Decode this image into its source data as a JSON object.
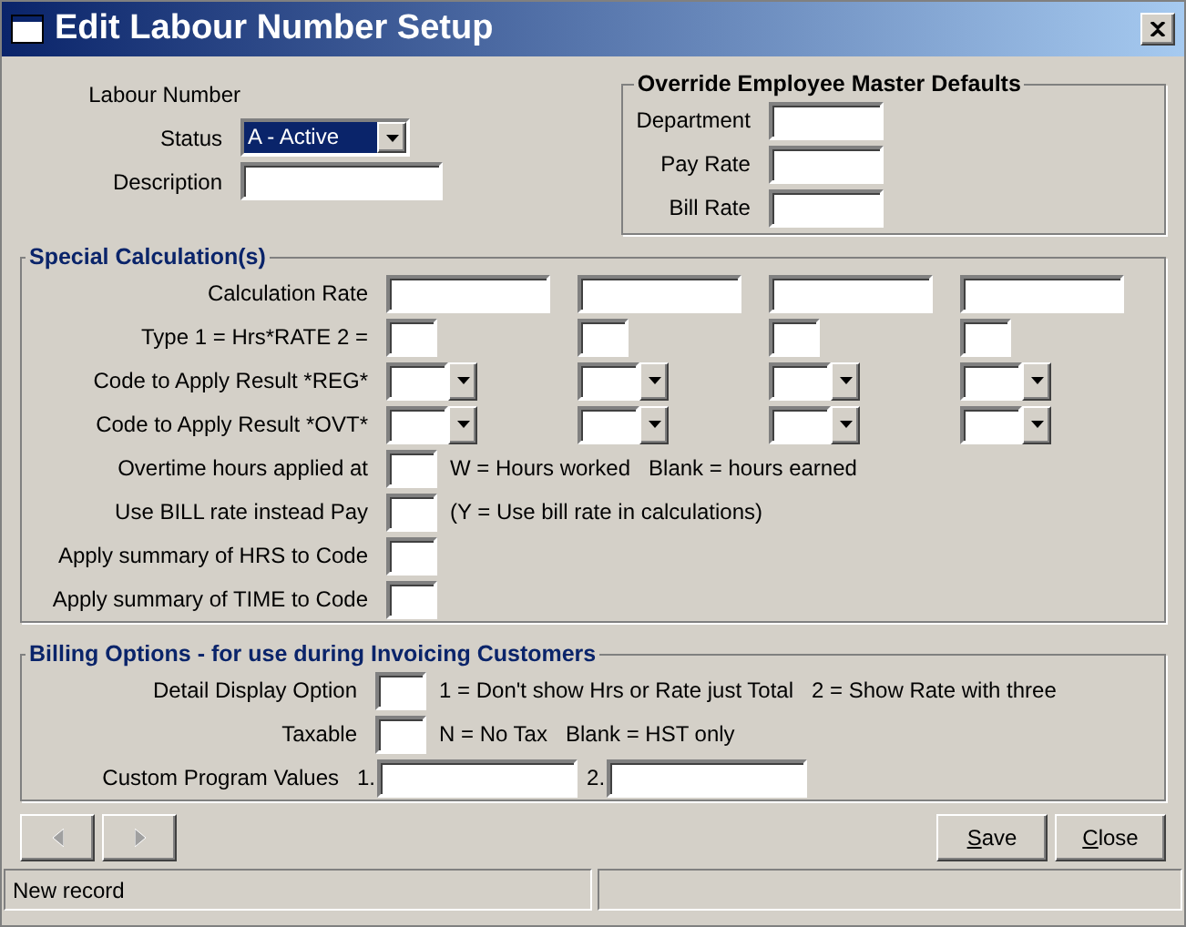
{
  "window": {
    "title": "Edit Labour Number Setup"
  },
  "header": {
    "labour_number_label": "Labour Number",
    "status": {
      "label": "Status",
      "value": "A - Active"
    },
    "description": {
      "label": "Description"
    }
  },
  "override": {
    "title": "Override Employee Master Defaults",
    "fields": [
      {
        "label": "Department"
      },
      {
        "label": "Pay Rate"
      },
      {
        "label": "Bill Rate"
      }
    ]
  },
  "special": {
    "title": "Special Calculation(s)",
    "rows": [
      {
        "kind": "wide",
        "label": "Calculation Rate"
      },
      {
        "kind": "small",
        "label": "Type 1 = Hrs*RATE  2 ="
      },
      {
        "kind": "combo",
        "label": "Code to Apply Result *REG*"
      },
      {
        "kind": "combo",
        "label": "Code to Apply Result *OVT*"
      },
      {
        "kind": "single",
        "label": "Overtime hours applied at",
        "note": "W = Hours worked   Blank = hours earned"
      },
      {
        "kind": "single",
        "label": "Use BILL rate instead Pay",
        "note": "(Y = Use bill rate in calculations)"
      },
      {
        "kind": "single",
        "label": "Apply summary of HRS to Code"
      },
      {
        "kind": "single",
        "label": "Apply summary of TIME to Code"
      }
    ]
  },
  "billing": {
    "title": "Billing Options - for use during Invoicing Customers",
    "rows": [
      {
        "kind": "single",
        "label": "Detail Display Option",
        "note": "1 = Don't show Hrs or Rate just Total   2 = Show Rate with three"
      },
      {
        "kind": "single",
        "label": "Taxable",
        "note": "N = No Tax   Blank = HST only"
      },
      {
        "kind": "custom",
        "label": "Custom Program Values",
        "prefixes": [
          "1.",
          "2."
        ]
      }
    ]
  },
  "nav_buttons": [
    {
      "kind": "prev",
      "disabled": true
    },
    {
      "kind": "next",
      "disabled": true
    }
  ],
  "buttons": [
    {
      "label": "Save"
    },
    {
      "label": "Close"
    }
  ],
  "status_bar": {
    "text": "New record"
  }
}
